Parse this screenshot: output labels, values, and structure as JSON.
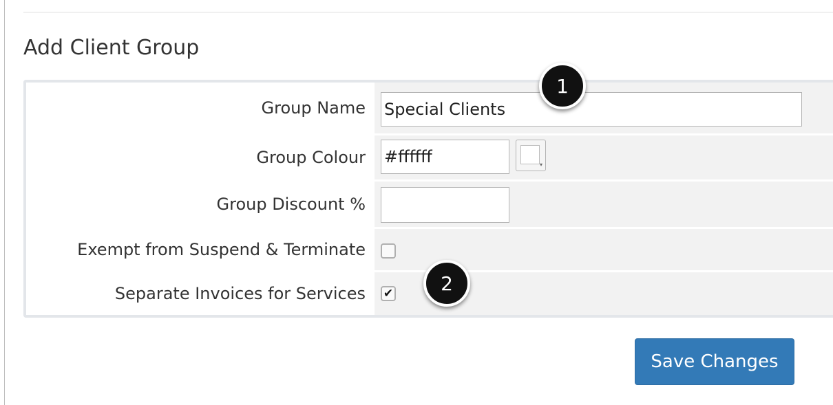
{
  "page": {
    "title": "Add Client Group"
  },
  "form": {
    "group_name": {
      "label": "Group Name",
      "value": "Special Clients"
    },
    "group_colour": {
      "label": "Group Colour",
      "value": "#ffffff",
      "picker_swatch_color": "#ffffff"
    },
    "group_discount": {
      "label": "Group Discount %",
      "value": ""
    },
    "exempt_suspend": {
      "label": "Exempt from Suspend & Terminate",
      "checked": false
    },
    "separate_invoices": {
      "label": "Separate Invoices for Services",
      "checked": true,
      "check_glyph": "✔"
    }
  },
  "callouts": [
    {
      "number": "1"
    },
    {
      "number": "2"
    }
  ],
  "actions": {
    "save_label": "Save Changes"
  },
  "colors": {
    "primary_button": "#337ab7",
    "field_cell_bg": "#f2f2f2",
    "callout_bg": "#111111"
  }
}
